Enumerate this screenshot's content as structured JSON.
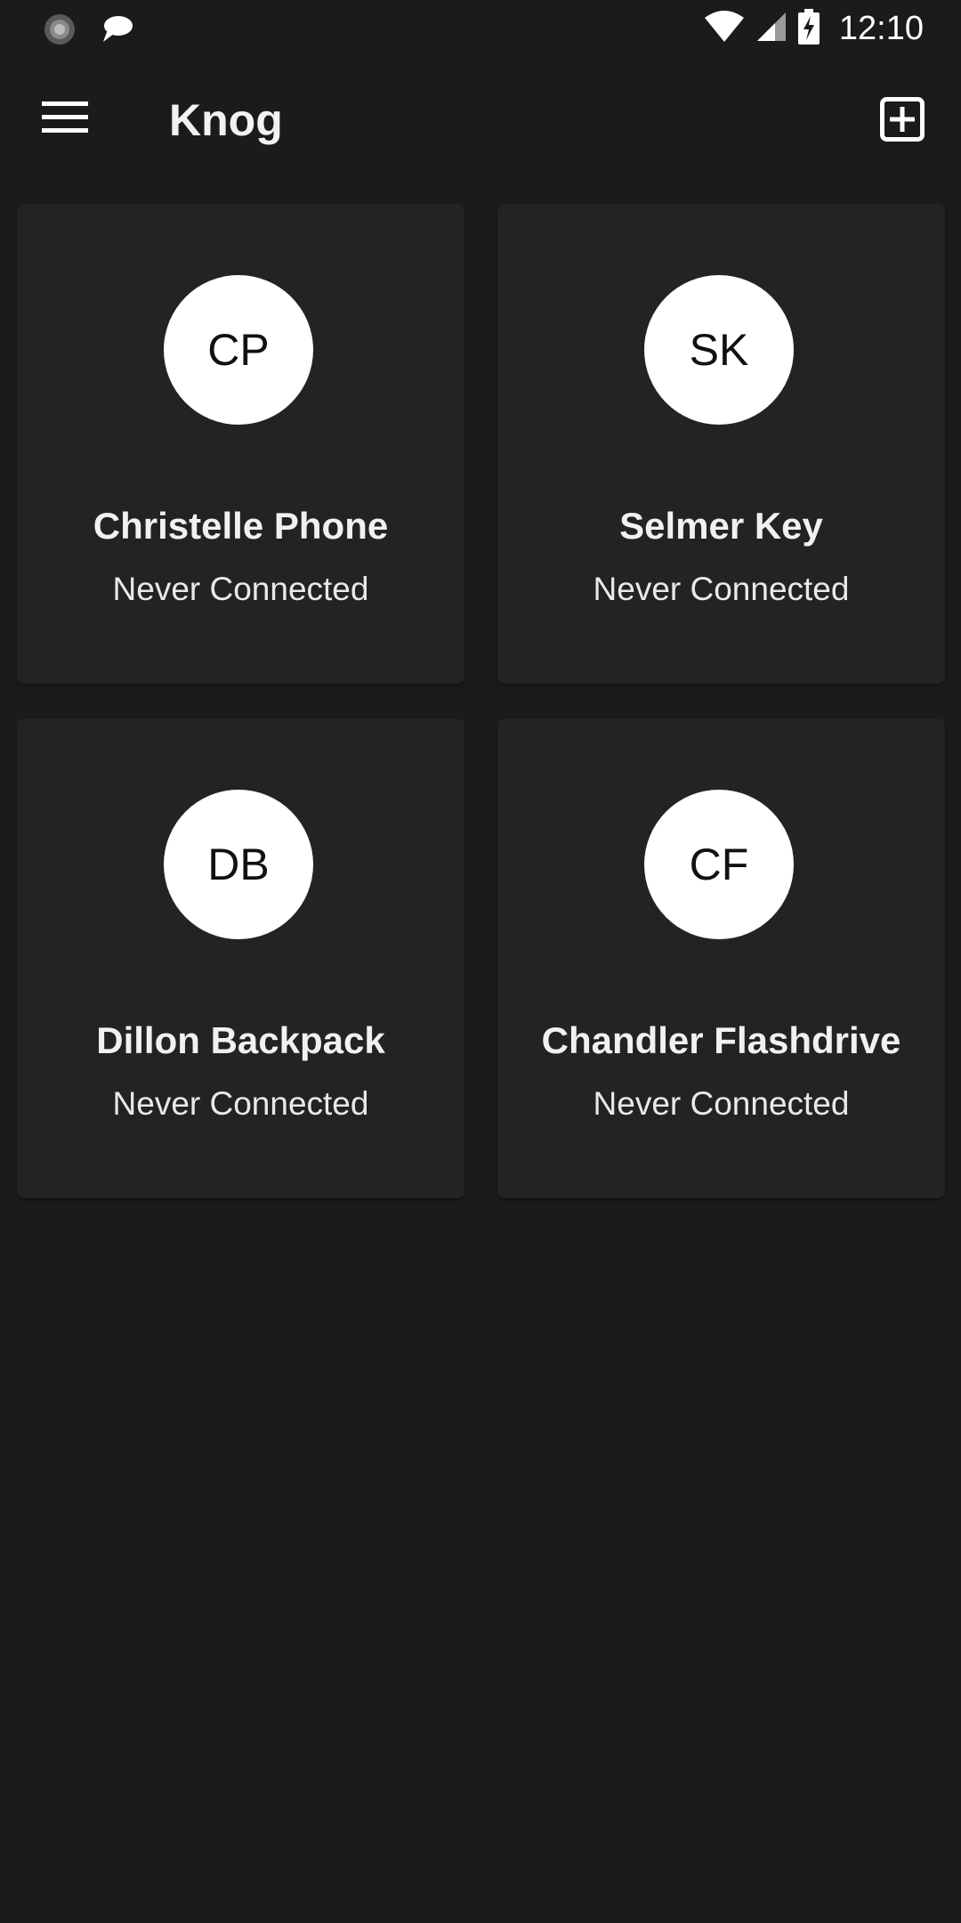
{
  "status_bar": {
    "time": "12:10",
    "icons": [
      "sync-icon",
      "chat-bubble-icon",
      "wifi-icon",
      "cell-signal-icon",
      "battery-charging-icon"
    ]
  },
  "app_bar": {
    "title": "Knog",
    "menu_icon": "hamburger-menu-icon",
    "add_icon": "add-box-icon"
  },
  "devices": [
    {
      "initials": "CP",
      "name": "Christelle Phone",
      "status": "Never Connected"
    },
    {
      "initials": "SK",
      "name": "Selmer Key",
      "status": "Never Connected"
    },
    {
      "initials": "DB",
      "name": "Dillon Backpack",
      "status": "Never Connected"
    },
    {
      "initials": "CF",
      "name": "Chandler Flashdrive",
      "status": "Never Connected"
    }
  ],
  "colors": {
    "background": "#1b1b1c",
    "card": "#232325",
    "avatar": "#ffffff",
    "text": "#ffffff"
  }
}
